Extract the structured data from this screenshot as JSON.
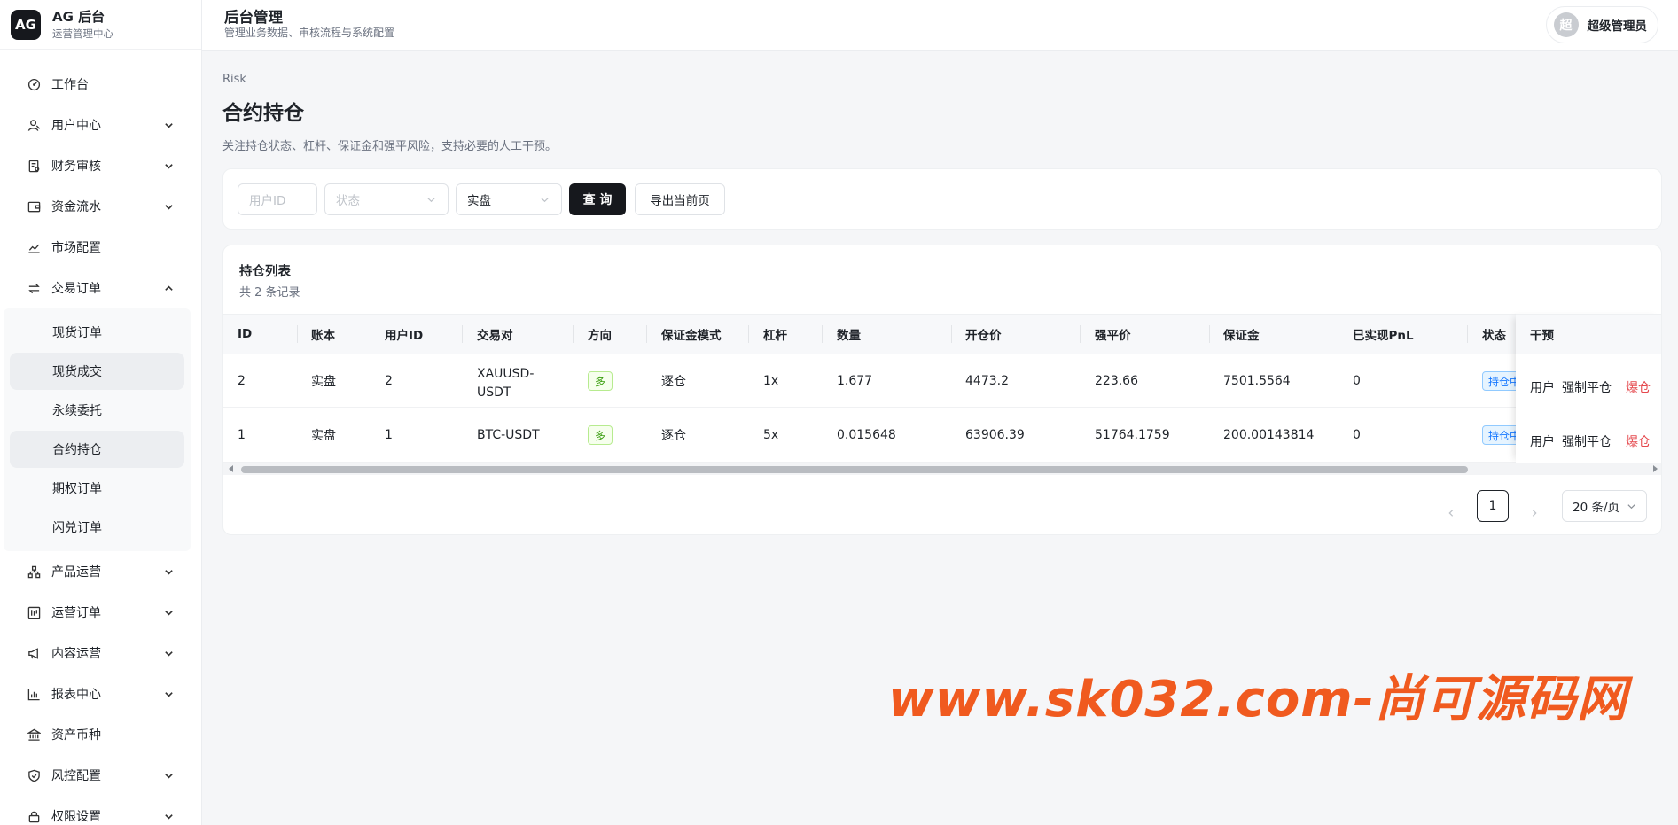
{
  "brand": {
    "logo": "AG",
    "title": "AG 后台",
    "subtitle": "运营管理中心"
  },
  "header": {
    "title": "后台管理",
    "subtitle": "管理业务数据、审核流程与系统配置"
  },
  "user": {
    "avatar_char": "超",
    "name": "超级管理员"
  },
  "sidebar": {
    "items": [
      {
        "label": "工作台",
        "icon": "dashboard-icon",
        "expandable": false
      },
      {
        "label": "用户中心",
        "icon": "user-icon",
        "expandable": true
      },
      {
        "label": "财务审核",
        "icon": "audit-icon",
        "expandable": true
      },
      {
        "label": "资金流水",
        "icon": "wallet-icon",
        "expandable": true
      },
      {
        "label": "市场配置",
        "icon": "chart-line-icon",
        "expandable": false
      },
      {
        "label": "交易订单",
        "icon": "swap-icon",
        "expandable": true,
        "expanded": true
      }
    ],
    "trade_sub": [
      "现货订单",
      "现货成交",
      "永续委托",
      "合约持仓",
      "期权订单",
      "闪兑订单"
    ],
    "items_after": [
      {
        "label": "产品运营",
        "icon": "cluster-icon"
      },
      {
        "label": "运营订单",
        "icon": "order-icon"
      },
      {
        "label": "内容运营",
        "icon": "megaphone-icon"
      },
      {
        "label": "报表中心",
        "icon": "bar-chart-icon"
      },
      {
        "label": "资产币种",
        "icon": "bank-icon",
        "expandable": false
      },
      {
        "label": "风控配置",
        "icon": "shield-icon"
      },
      {
        "label": "权限设置",
        "icon": "lock-icon"
      }
    ]
  },
  "page": {
    "breadcrumb": "Risk",
    "title": "合约持仓",
    "description": "关注持仓状态、杠杆、保证金和强平风险，支持必要的人工干预。"
  },
  "filters": {
    "user_id_placeholder": "用户ID",
    "status_placeholder": "状态",
    "account_value": "实盘",
    "query_label": "查 询",
    "export_label": "导出当前页"
  },
  "table": {
    "title": "持仓列表",
    "count_text": "共 2 条记录",
    "columns": [
      "ID",
      "账本",
      "用户ID",
      "交易对",
      "方向",
      "保证金模式",
      "杠杆",
      "数量",
      "开仓价",
      "强平价",
      "保证金",
      "已实现PnL",
      "状态",
      "干预"
    ],
    "rows": [
      {
        "id": "2",
        "book": "实盘",
        "user_id": "2",
        "pair": "XAUUSD-USDT",
        "pair_l1": "XAUUSD-",
        "pair_l2": "USDT",
        "side": "多",
        "margin_mode": "逐仓",
        "leverage": "1x",
        "qty": "1.677",
        "open_price": "4473.2",
        "liq_price": "223.66",
        "margin": "7501.5564",
        "pnl": "0",
        "status": "持仓中",
        "actions": [
          "用户",
          "强制平仓",
          "爆仓"
        ]
      },
      {
        "id": "1",
        "book": "实盘",
        "user_id": "1",
        "pair": "BTC-USDT",
        "side": "多",
        "margin_mode": "逐仓",
        "leverage": "5x",
        "qty": "0.015648",
        "open_price": "63906.39",
        "liq_price": "51764.1759",
        "margin": "200.00143814",
        "pnl": "0",
        "status": "持仓中",
        "actions": [
          "用户",
          "强制平仓",
          "爆仓"
        ]
      }
    ]
  },
  "pagination": {
    "current": "1",
    "page_size": "20 条/页"
  },
  "watermark": "www.sk032.com-尚可源码网",
  "colors": {
    "accent_dark": "#16181d",
    "danger": "#e5484d",
    "long_tag": "#389e0d",
    "status_tag": "#1677ff",
    "watermark": "#f05a1f"
  }
}
